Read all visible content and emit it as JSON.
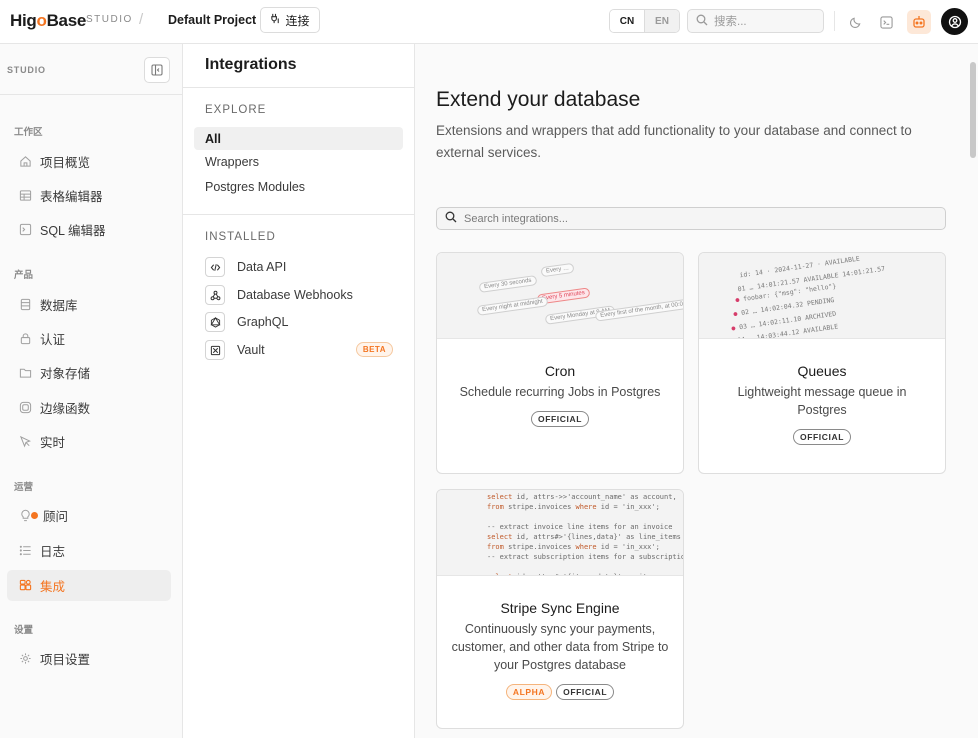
{
  "topbar": {
    "logo_prefix": "Hig",
    "logo_o": "o",
    "logo_suffix": "Base",
    "studio": "STUDIO",
    "separator": "/",
    "project": "Default Project",
    "connect_label": "连接",
    "lang_cn": "CN",
    "lang_en": "EN",
    "search_placeholder": "搜索..."
  },
  "sidebar": {
    "header": "STUDIO",
    "sections": {
      "workspace": "工作区",
      "product": "产品",
      "ops": "运营",
      "settings": "设置"
    },
    "items": [
      {
        "label": "项目概览",
        "icon": "home-icon"
      },
      {
        "label": "表格编辑器",
        "icon": "table-icon"
      },
      {
        "label": "SQL 编辑器",
        "icon": "terminal-icon"
      },
      {
        "label": "数据库",
        "icon": "database-icon"
      },
      {
        "label": "认证",
        "icon": "lock-icon"
      },
      {
        "label": "对象存储",
        "icon": "folder-icon"
      },
      {
        "label": "边缘函数",
        "icon": "functions-icon"
      },
      {
        "label": "实时",
        "icon": "cursor-icon"
      },
      {
        "label": "顾问",
        "icon": "lightbulb-icon"
      },
      {
        "label": "日志",
        "icon": "list-icon"
      },
      {
        "label": "集成",
        "icon": "integrations-icon",
        "active": true
      },
      {
        "label": "项目设置",
        "icon": "gear-icon"
      }
    ]
  },
  "integrations_panel": {
    "title": "Integrations",
    "explore_heading": "EXPLORE",
    "explore_items": [
      "All",
      "Wrappers",
      "Postgres Modules"
    ],
    "installed_heading": "INSTALLED",
    "installed_items": [
      {
        "label": "Data API",
        "icon": "code-icon"
      },
      {
        "label": "Database Webhooks",
        "icon": "webhook-icon"
      },
      {
        "label": "GraphQL",
        "icon": "graphql-icon"
      },
      {
        "label": "Vault",
        "icon": "vault-icon",
        "badge": "BETA"
      }
    ]
  },
  "main": {
    "title": "Extend your database",
    "description": "Extensions and wrappers that add functionality to your database and connect to external services.",
    "search_placeholder": "Search integrations...",
    "cards": [
      {
        "title": "Cron",
        "description": "Schedule recurring Jobs in Postgres",
        "badges": [
          "OFFICIAL"
        ]
      },
      {
        "title": "Queues",
        "description": "Lightweight message queue in Postgres",
        "badges": [
          "OFFICIAL"
        ]
      },
      {
        "title": "Stripe Sync Engine",
        "description": "Continuously sync your payments, customer, and other data from Stripe to your Postgres database",
        "badges": [
          "ALPHA",
          "OFFICIAL"
        ]
      }
    ]
  },
  "colors": {
    "accent": "#f47521",
    "border": "#e6e6e6",
    "sidebar_bg": "#fafafa"
  }
}
